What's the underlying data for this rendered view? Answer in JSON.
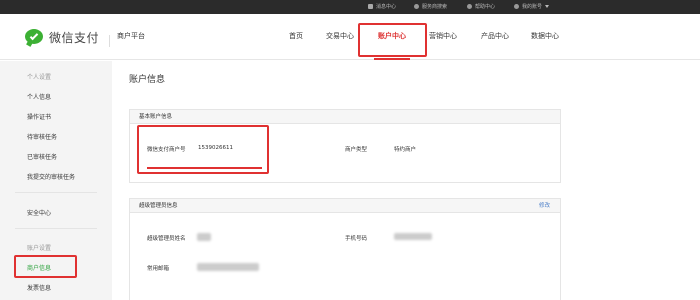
{
  "topbar": {
    "items": [
      {
        "label": "消息中心",
        "icon": "mail-icon"
      },
      {
        "label": "服务商搜索",
        "icon": "search-icon"
      },
      {
        "label": "帮助中心",
        "icon": "help-icon"
      },
      {
        "label": "我的账号",
        "icon": "user-icon"
      }
    ]
  },
  "header": {
    "logo_text": "微信支付",
    "platform": "商户平台",
    "nav": [
      {
        "label": "首页",
        "active": false
      },
      {
        "label": "交易中心",
        "active": false
      },
      {
        "label": "账户中心",
        "active": true
      },
      {
        "label": "营销中心",
        "active": false
      },
      {
        "label": "产品中心",
        "active": false
      },
      {
        "label": "数据中心",
        "active": false
      }
    ]
  },
  "sidebar": {
    "group_personal": "个人设置",
    "personal_items": [
      "个人信息",
      "操作证书",
      "待审核任务",
      "已审核任务",
      "我提交的审核任务"
    ],
    "security": "安全中心",
    "group_account": "账户设置",
    "account_items": [
      "商户信息",
      "发票信息"
    ],
    "selected": "商户信息"
  },
  "content": {
    "title": "账户信息",
    "basic": {
      "heading": "基本账户信息",
      "merchant_no_label": "微信支付商户号",
      "merchant_no_value": "1539026611",
      "merchant_type_label": "商户类型",
      "merchant_type_value": "特约商户"
    },
    "admin": {
      "heading": "超级管理员信息",
      "edit_label": "修改",
      "name_label": "超级管理员姓名",
      "phone_label": "手机号码",
      "email_label": "常用邮箱"
    }
  },
  "colors": {
    "accent_red": "#e03131",
    "brand_green": "#3cb034",
    "selected_green": "#2aa13b",
    "link_blue": "#4a7ec8",
    "topbar_bg": "#2b2b2b"
  }
}
